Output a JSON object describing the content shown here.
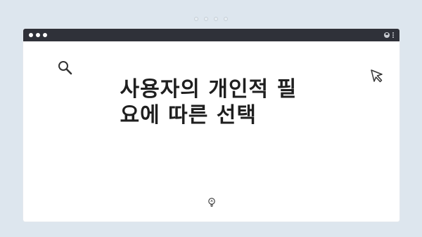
{
  "headline": "사용자의 개인적 필요에 따른 선택",
  "icons": {
    "search": "search-icon",
    "cursor": "cursor-icon",
    "lightbulb": "lightbulb-icon"
  },
  "colors": {
    "background": "#dde6ee",
    "titlebar": "#2f3139",
    "text": "#1f1f1f"
  }
}
